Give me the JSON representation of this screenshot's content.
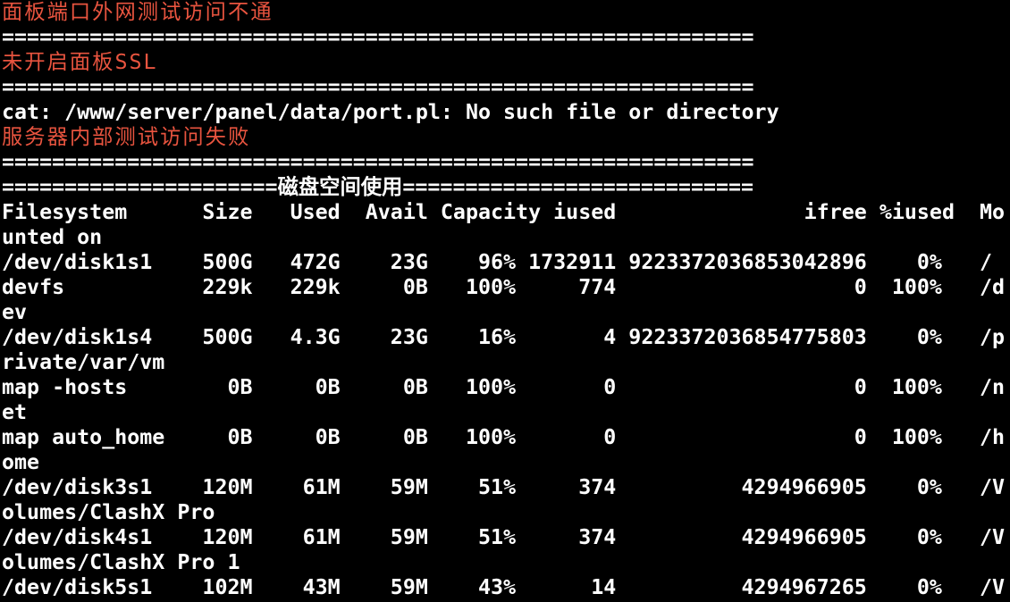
{
  "colors": {
    "background": "#000000",
    "text": "#ffffff",
    "warning": "#e8543f"
  },
  "terminal": {
    "lines": [
      {
        "text": "面板端口外网测试访问不通",
        "color": "warning"
      },
      {
        "text": "============================================================",
        "color": "text"
      },
      {
        "text": "未开启面板SSL",
        "color": "warning"
      },
      {
        "text": "============================================================",
        "color": "text"
      },
      {
        "text": "cat: /www/server/panel/data/port.pl: No such file or directory",
        "color": "text"
      },
      {
        "text": "服务器内部测试访问失败",
        "color": "warning"
      },
      {
        "text": "============================================================",
        "color": "text"
      },
      {
        "text": "======================磁盘空间使用============================",
        "color": "text"
      },
      {
        "text": "Filesystem      Size   Used  Avail Capacity iused               ifree %iused  Mo",
        "color": "text"
      },
      {
        "text": "unted on",
        "color": "text"
      },
      {
        "text": "/dev/disk1s1    500G   472G    23G    96% 1732911 9223372036853042896    0%   /",
        "color": "text"
      },
      {
        "text": "devfs           229k   229k     0B   100%     774                   0  100%   /d",
        "color": "text"
      },
      {
        "text": "ev",
        "color": "text"
      },
      {
        "text": "/dev/disk1s4    500G   4.3G    23G    16%       4 9223372036854775803    0%   /p",
        "color": "text"
      },
      {
        "text": "rivate/var/vm",
        "color": "text"
      },
      {
        "text": "map -hosts        0B     0B     0B   100%       0                   0  100%   /n",
        "color": "text"
      },
      {
        "text": "et",
        "color": "text"
      },
      {
        "text": "map auto_home     0B     0B     0B   100%       0                   0  100%   /h",
        "color": "text"
      },
      {
        "text": "ome",
        "color": "text"
      },
      {
        "text": "/dev/disk3s1    120M    61M    59M    51%     374          4294966905    0%   /V",
        "color": "text"
      },
      {
        "text": "olumes/ClashX Pro",
        "color": "text"
      },
      {
        "text": "/dev/disk4s1    120M    61M    59M    51%     374          4294966905    0%   /V",
        "color": "text"
      },
      {
        "text": "olumes/ClashX Pro 1",
        "color": "text"
      },
      {
        "text": "/dev/disk5s1    102M    43M    59M    43%      14          4294967265    0%   /V",
        "color": "text"
      }
    ]
  }
}
